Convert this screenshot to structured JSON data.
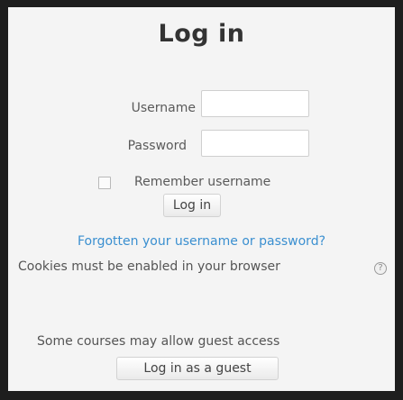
{
  "login": {
    "title": "Log in",
    "username_label": "Username",
    "username_value": "",
    "password_label": "Password",
    "password_value": "",
    "remember_label": "Remember username",
    "remember_checked": false,
    "login_button": "Log in",
    "forgot_link": "Forgotten your username or password?",
    "cookies_note": "Cookies must be enabled in your browser",
    "help_icon": "question-mark-circle-icon"
  },
  "guest": {
    "note": "Some courses may allow guest access",
    "button": "Log in as a guest"
  },
  "colors": {
    "link": "#3a8fd0",
    "frame": "#1e1e1e",
    "background": "#f4f4f4"
  }
}
